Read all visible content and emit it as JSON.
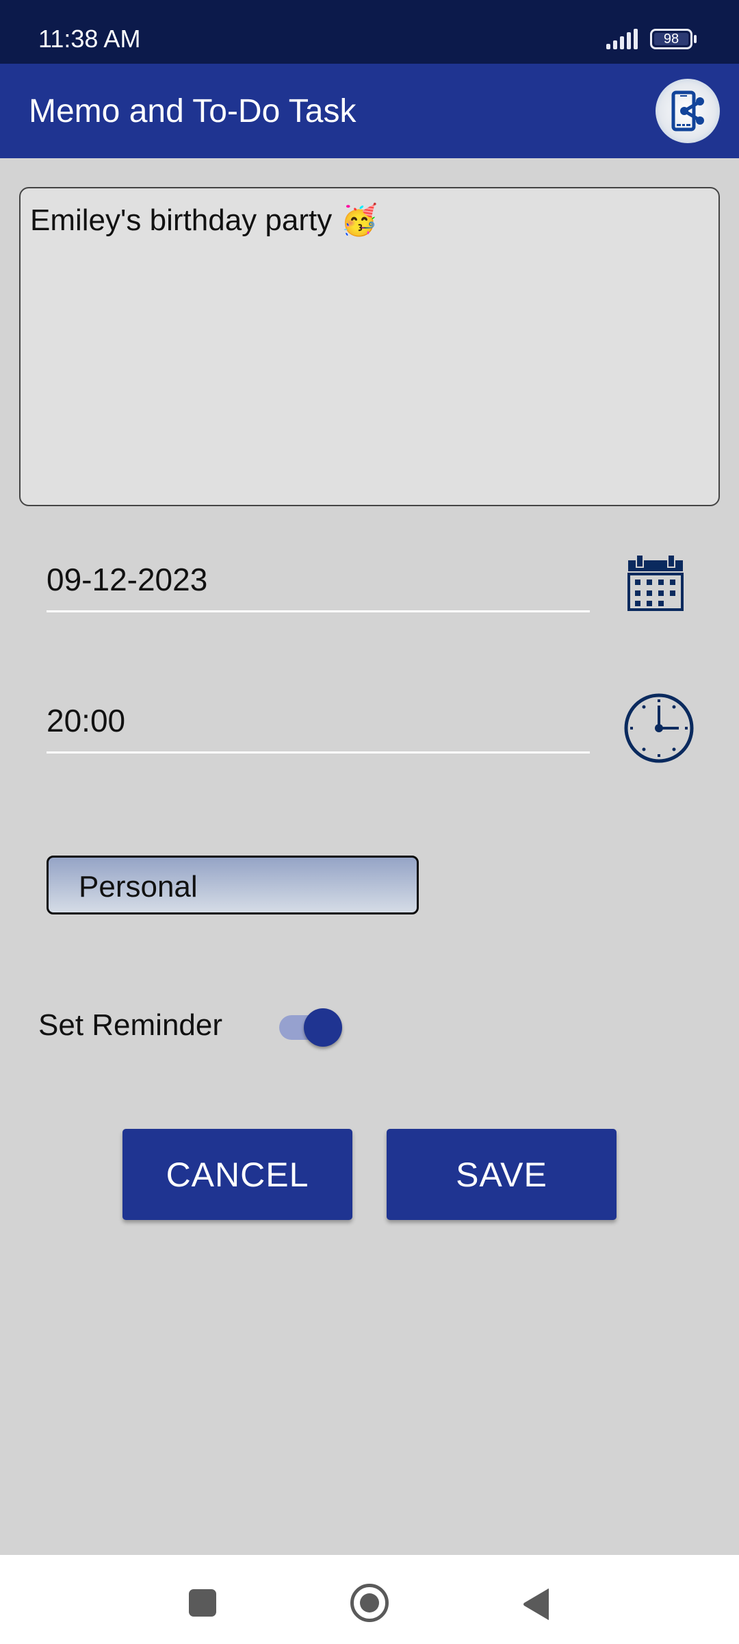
{
  "status_bar": {
    "time": "11:38 AM",
    "battery_level": "98",
    "icons": [
      "signal-icon",
      "battery-icon"
    ]
  },
  "app_bar": {
    "title": "Memo and To-Do Task",
    "share_icon": "share-phone-icon"
  },
  "memo": {
    "text": "Emiley's birthday party 🥳"
  },
  "date_field": {
    "value": "09-12-2023",
    "icon": "calendar-icon"
  },
  "time_field": {
    "value": "20:00",
    "icon": "clock-icon"
  },
  "category": {
    "selected": "Personal"
  },
  "reminder": {
    "label": "Set Reminder",
    "enabled": true
  },
  "buttons": {
    "cancel_label": "CANCEL",
    "save_label": "SAVE"
  },
  "colors": {
    "status_bar": "#0c1a4b",
    "primary": "#1f3491",
    "icon_dark": "#0a2a5e",
    "background": "#d3d3d3"
  },
  "nav_bar": {
    "icons": [
      "recent-apps-icon",
      "home-icon",
      "back-icon"
    ]
  }
}
